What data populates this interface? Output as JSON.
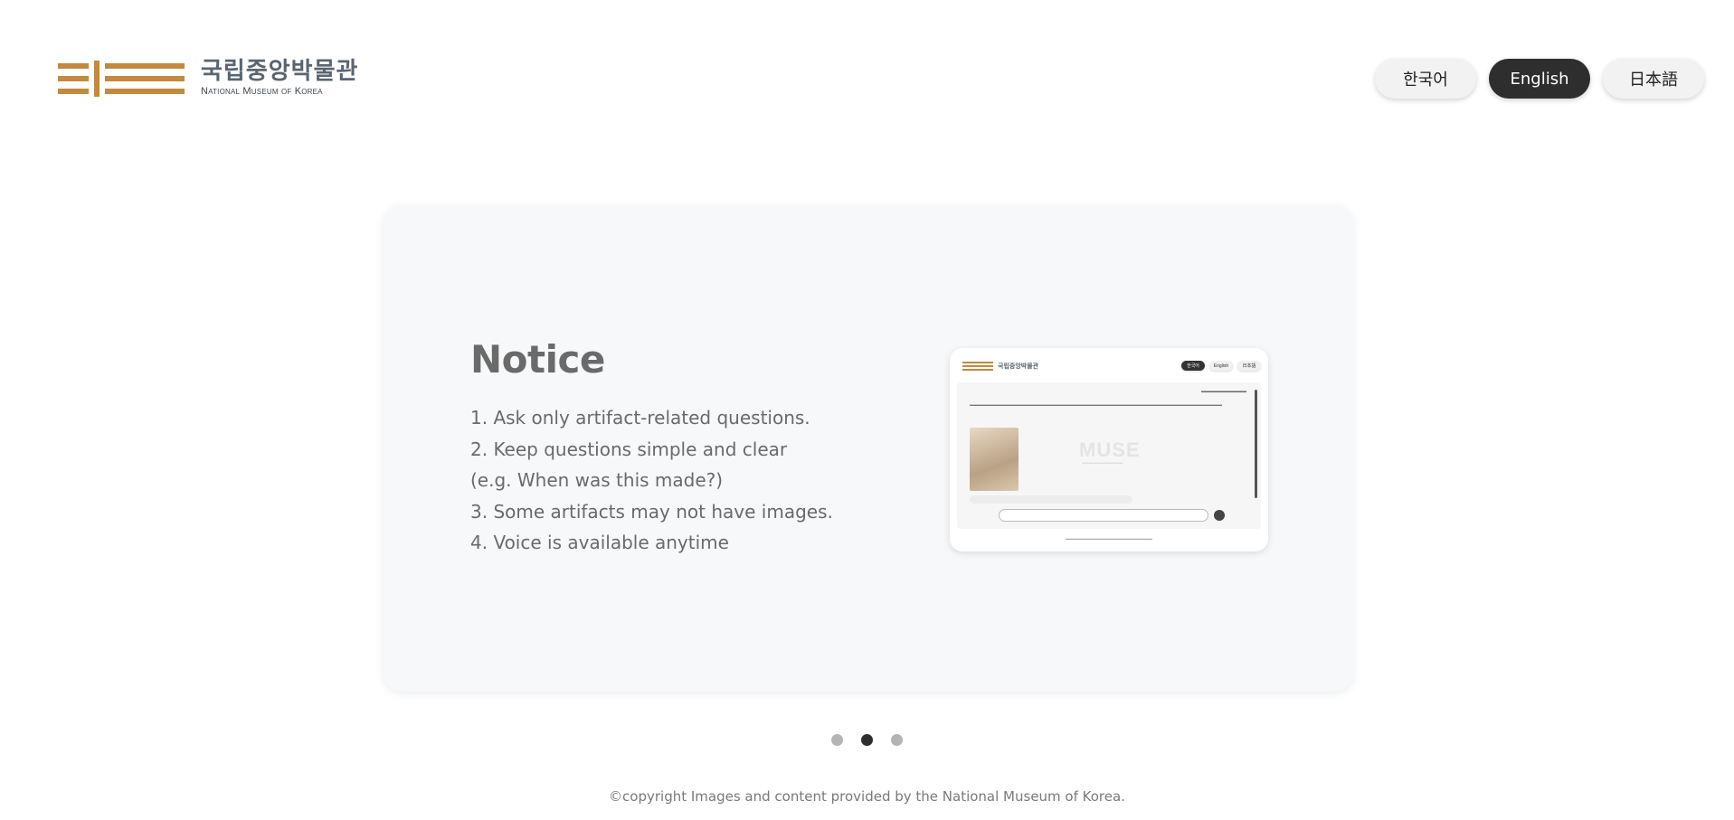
{
  "header": {
    "logo_ko": "국립중앙박물관",
    "logo_en": "National Museum of Korea"
  },
  "languages": [
    {
      "label": "한국어",
      "active": false
    },
    {
      "label": "English",
      "active": true
    },
    {
      "label": "日本語",
      "active": false
    }
  ],
  "notice": {
    "title": "Notice",
    "items": [
      "1. Ask only artifact-related questions.",
      "2. Keep questions simple and clear",
      "(e.g. When was this made?)",
      "3. Some artifacts may not have images.",
      "4. Voice is available anytime"
    ]
  },
  "preview": {
    "logo_ko": "국립중앙박물관",
    "langs": [
      "한국어",
      "English",
      "日本語"
    ],
    "watermark": "MUSE"
  },
  "carousel": {
    "total_slides": 3,
    "active_slide": 2
  },
  "footer": {
    "copyright": "©copyright Images and content provided by the National Museum of Korea."
  },
  "colors": {
    "brand_gold": "#c2893f",
    "active_dark": "#2e2e2e"
  }
}
